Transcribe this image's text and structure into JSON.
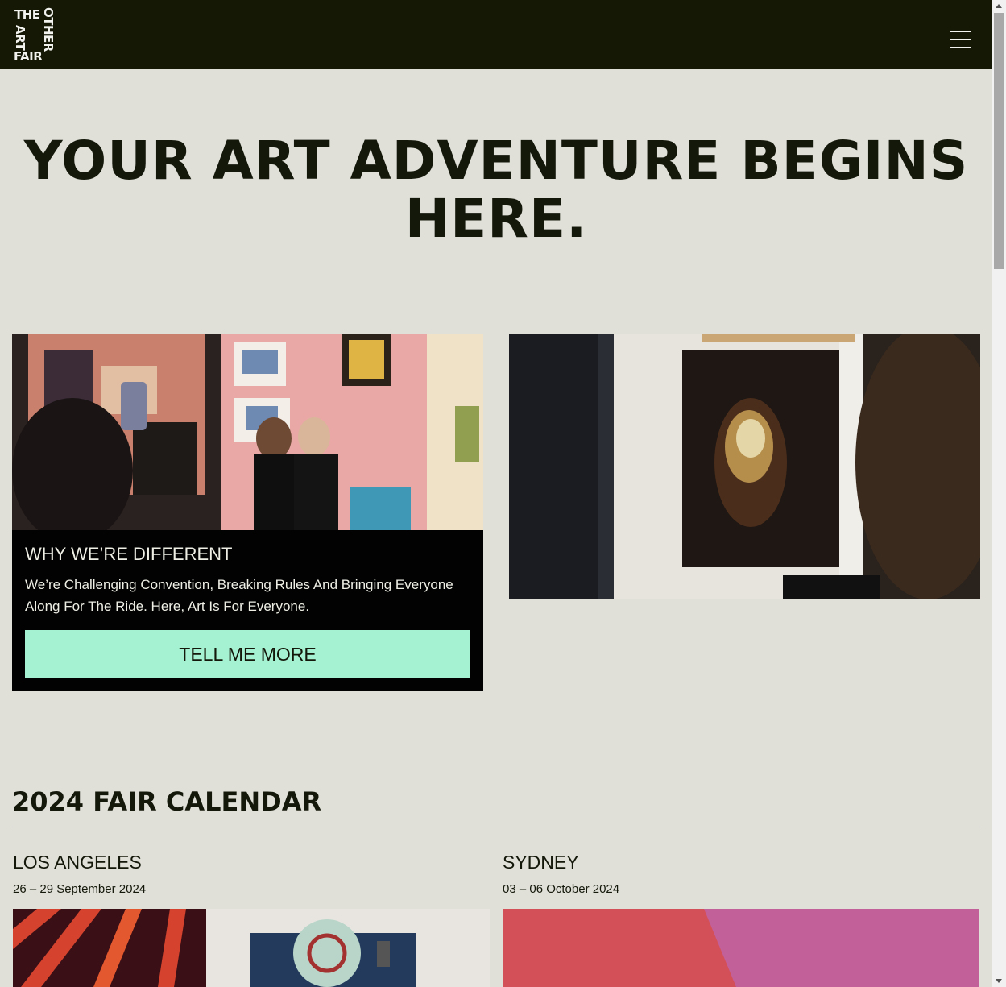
{
  "header": {
    "logo_words": [
      "THE",
      "ART",
      "FAIR",
      "OTHER"
    ],
    "menu_label": "Menu"
  },
  "hero": {
    "title_line1": "YOUR ART ADVENTURE BEGINS",
    "title_line2": "HERE."
  },
  "feature_card": {
    "title": "WHY WE’RE DIFFERENT",
    "text": "We’re Challenging Convention, Breaking Rules And Bringing Everyone Along For The Ride. Here, Art Is For Everyone.",
    "button_label": "TELL ME MORE"
  },
  "calendar": {
    "title": "2024 FAIR CALENDAR",
    "events": [
      {
        "city": "LOS ANGELES",
        "dates": "26 – 29 September 2024"
      },
      {
        "city": "SYDNEY",
        "dates": "03 – 06 October 2024"
      }
    ]
  },
  "colors": {
    "header_bg": "#141805",
    "page_bg": "#e0e0d9",
    "accent": "#a4f2d1",
    "card_bg": "#020202"
  }
}
